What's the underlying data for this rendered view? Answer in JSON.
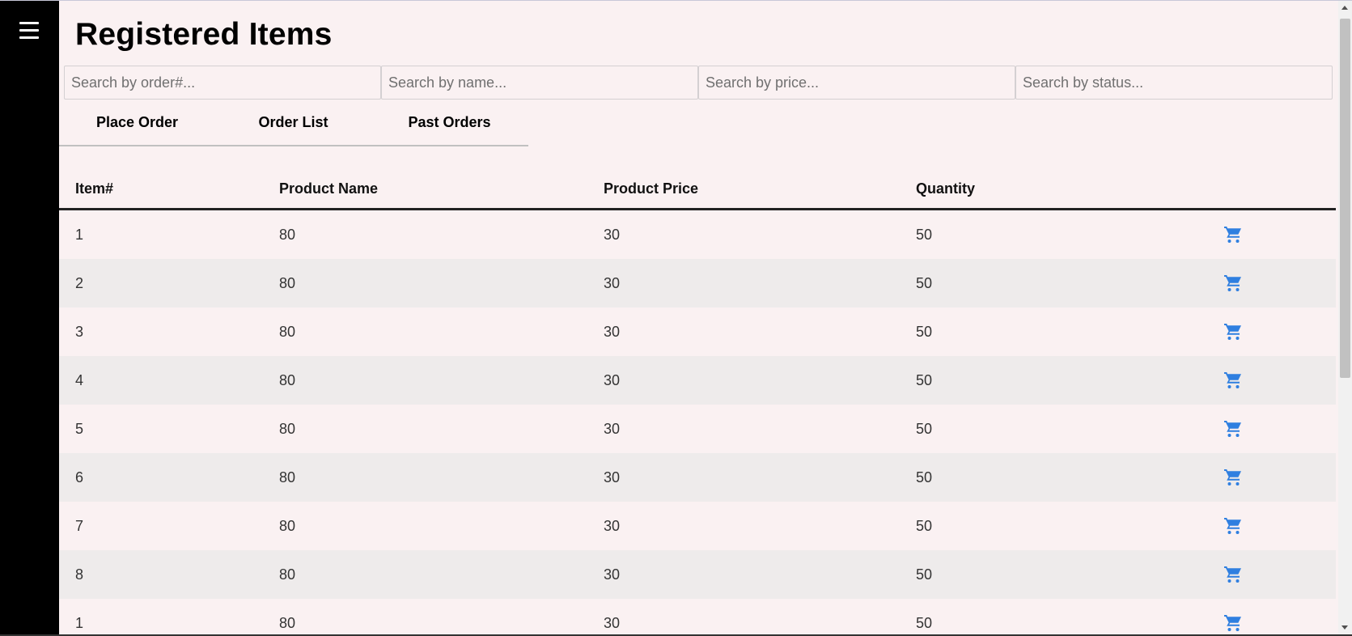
{
  "header": {
    "title": "Registered Items"
  },
  "search": {
    "order_placeholder": "Search by order#...",
    "name_placeholder": "Search by name...",
    "price_placeholder": "Search by price...",
    "status_placeholder": "Search by status..."
  },
  "tabs": [
    {
      "label": "Place Order"
    },
    {
      "label": "Order List"
    },
    {
      "label": "Past Orders"
    }
  ],
  "table": {
    "columns": [
      "Item#",
      "Product Name",
      "Product Price",
      "Quantity"
    ],
    "rows": [
      {
        "item": "1",
        "name": "80",
        "price": "30",
        "quantity": "50"
      },
      {
        "item": "2",
        "name": "80",
        "price": "30",
        "quantity": "50"
      },
      {
        "item": "3",
        "name": "80",
        "price": "30",
        "quantity": "50"
      },
      {
        "item": "4",
        "name": "80",
        "price": "30",
        "quantity": "50"
      },
      {
        "item": "5",
        "name": "80",
        "price": "30",
        "quantity": "50"
      },
      {
        "item": "6",
        "name": "80",
        "price": "30",
        "quantity": "50"
      },
      {
        "item": "7",
        "name": "80",
        "price": "30",
        "quantity": "50"
      },
      {
        "item": "8",
        "name": "80",
        "price": "30",
        "quantity": "50"
      },
      {
        "item": "1",
        "name": "80",
        "price": "30",
        "quantity": "50"
      }
    ],
    "action_icon": "shopping-cart-icon"
  },
  "colors": {
    "sidebar": "#000000",
    "background": "#faf1f2",
    "stripe": "#eeebeb",
    "cart_icon": "#2f7fe0"
  }
}
